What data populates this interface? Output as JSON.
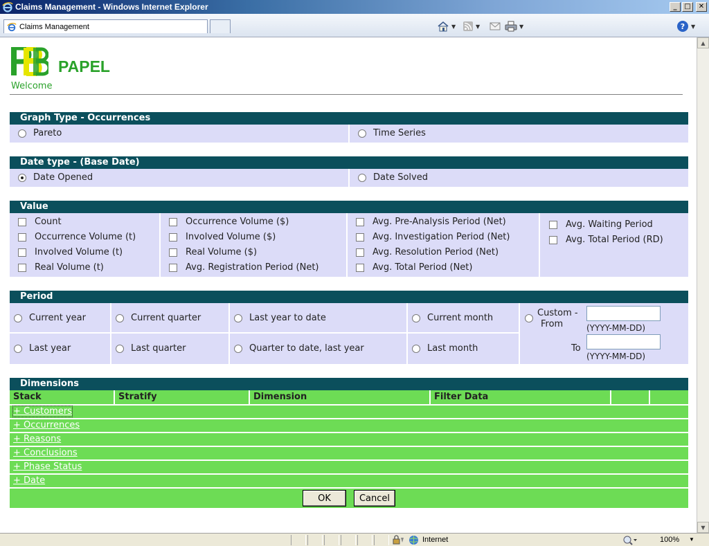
{
  "window": {
    "title": "Claims Management - Windows Internet Explorer",
    "minimize": "_",
    "maximize": "□",
    "close": "✕"
  },
  "browser": {
    "tab_title": "Claims Management",
    "icons": [
      "ie-icon",
      "home-icon",
      "feeds-icon",
      "mail-icon",
      "print-icon",
      "help-icon"
    ]
  },
  "header": {
    "brand": "PAPEL",
    "welcome": "Welcome"
  },
  "graph_type": {
    "title": "Graph Type - Occurrences",
    "options": [
      {
        "label": "Pareto",
        "checked": false
      },
      {
        "label": "Time Series",
        "checked": false
      }
    ]
  },
  "date_type": {
    "title": "Date type - (Base Date)",
    "options": [
      {
        "label": "Date Opened",
        "checked": true
      },
      {
        "label": "Date Solved",
        "checked": false
      }
    ]
  },
  "value": {
    "title": "Value",
    "col1": [
      "Count",
      "Occurrence Volume (t)",
      "Involved Volume (t)",
      "Real Volume (t)"
    ],
    "col2": [
      "Occurrence Volume ($)",
      "Involved Volume ($)",
      "Real Volume ($)",
      "Avg. Registration Period (Net)"
    ],
    "col3": [
      "Avg. Pre-Analysis Period (Net)",
      "Avg. Investigation Period (Net)",
      "Avg. Resolution Period (Net)",
      "Avg. Total Period (Net)"
    ],
    "col4": [
      "Avg. Waiting Period",
      "Avg. Total Period (RD)"
    ]
  },
  "period": {
    "title": "Period",
    "row1": [
      "Current year",
      "Current quarter",
      "Last year to date",
      "Current month"
    ],
    "row2": [
      "Last year",
      "Last quarter",
      "Quarter to date, last year",
      "Last month"
    ],
    "custom_label": "Custom -",
    "from_label": "From",
    "to_label": "To",
    "date_hint": "(YYYY-MM-DD)",
    "from_value": "",
    "to_value": ""
  },
  "dimensions": {
    "title": "Dimensions",
    "columns": [
      "Stack",
      "Stratify",
      "Dimension",
      "Filter Data",
      "",
      ""
    ],
    "rows": [
      "+ Customers",
      "+ Occurrences",
      "+ Reasons",
      "+ Conclusions",
      "+ Phase Status",
      "+ Date"
    ],
    "ok": "OK",
    "cancel": "Cancel"
  },
  "status": {
    "zone": "Internet",
    "zoom": "100%"
  }
}
